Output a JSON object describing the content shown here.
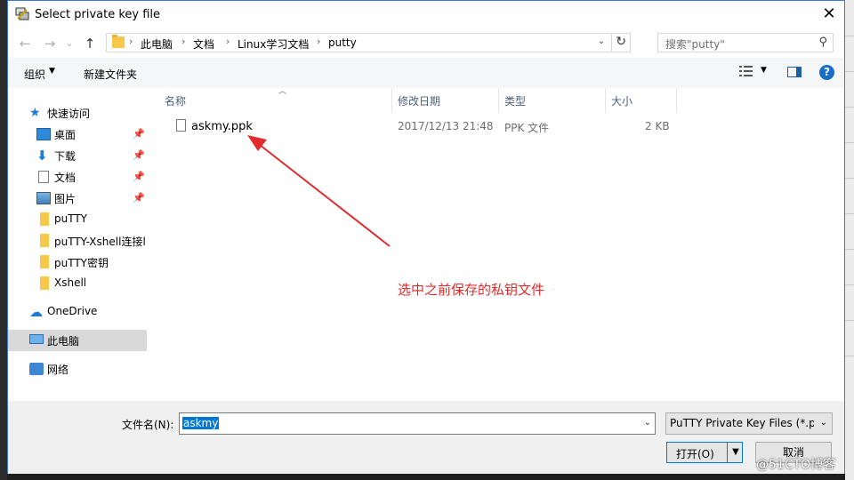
{
  "window": {
    "title": "Select private key file"
  },
  "address": {
    "crumbs": [
      "此电脑",
      "文档",
      "Linux学习文档",
      "putty"
    ],
    "search_placeholder": "搜索\"putty\""
  },
  "toolbar": {
    "organize": "组织",
    "new_folder": "新建文件夹"
  },
  "nav": {
    "quick_access": "快速访问",
    "items": [
      {
        "label": "桌面"
      },
      {
        "label": "下载"
      },
      {
        "label": "文档"
      },
      {
        "label": "图片"
      },
      {
        "label": "puTTY"
      },
      {
        "label": "puTTY-Xshell连接l"
      },
      {
        "label": "puTTY密钥"
      },
      {
        "label": "Xshell"
      }
    ],
    "onedrive": "OneDrive",
    "this_pc": "此电脑",
    "network": "网络"
  },
  "columns": {
    "name": "名称",
    "modified": "修改日期",
    "type": "类型",
    "size": "大小"
  },
  "files": [
    {
      "name": "askmy.ppk",
      "modified": "2017/12/13 21:48",
      "type": "PPK 文件",
      "size": "2 KB"
    }
  ],
  "annotation": {
    "text": "选中之前保存的私钥文件",
    "color": "#e02c2c"
  },
  "footer": {
    "filename_label": "文件名(N):",
    "filename_value": "askmy",
    "filetype_value": "PuTTY Private Key Files (*.pp",
    "open_label": "打开(O)",
    "cancel_label": "取消"
  },
  "watermark": "@51CTO博客",
  "colors": {
    "accent": "#0078d7",
    "selected_nav": "#d9d9d9"
  }
}
